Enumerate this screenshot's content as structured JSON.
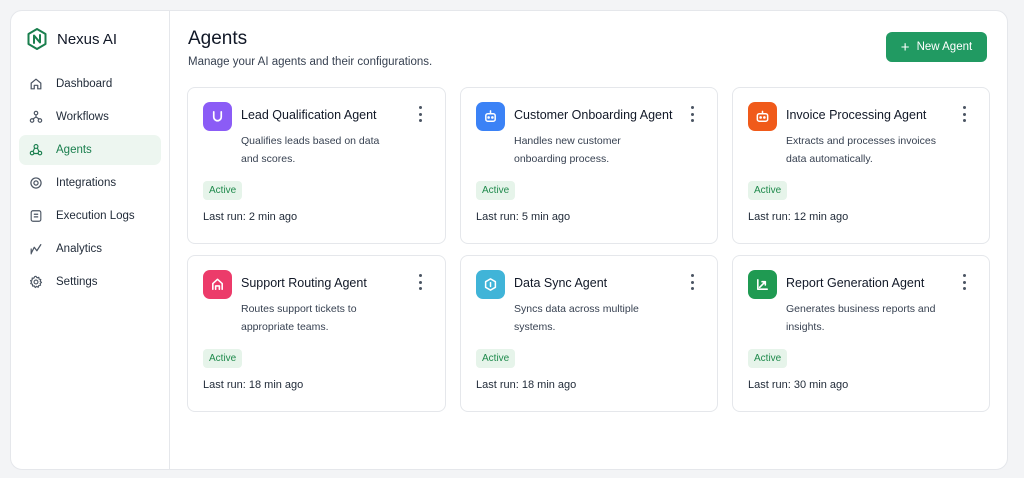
{
  "app": {
    "name": "Nexus AI"
  },
  "sidebar": {
    "items": [
      {
        "label": "Dashboard",
        "icon": "home-icon",
        "active": false
      },
      {
        "label": "Workflows",
        "icon": "workflow-icon",
        "active": false
      },
      {
        "label": "Agents",
        "icon": "agents-icon",
        "active": true
      },
      {
        "label": "Integrations",
        "icon": "integrations-icon",
        "active": false
      },
      {
        "label": "Execution Logs",
        "icon": "logs-icon",
        "active": false
      },
      {
        "label": "Analytics",
        "icon": "analytics-icon",
        "active": false
      },
      {
        "label": "Settings",
        "icon": "gear-icon",
        "active": false
      }
    ]
  },
  "header": {
    "title": "Agents",
    "subtitle": "Manage your AI agents and their configurations.",
    "new_button_label": "New Agent"
  },
  "agents": [
    {
      "name": "Lead Qualification Agent",
      "desc": "Qualifies leads based on data and scores.",
      "status": "Active",
      "last_run": "Last run: 2 min ago",
      "icon": "magnet-icon",
      "color": "#8b5cf6"
    },
    {
      "name": "Customer Onboarding Agent",
      "desc": "Handles new customer onboarding process.",
      "status": "Active",
      "last_run": "Last run: 5 min ago",
      "icon": "bot-icon",
      "color": "#3b82f6"
    },
    {
      "name": "Invoice Processing Agent",
      "desc": "Extracts and processes invoices data automatically.",
      "status": "Active",
      "last_run": "Last run: 12 min ago",
      "icon": "invoice-icon",
      "color": "#f05a1a"
    },
    {
      "name": "Support Routing Agent",
      "desc": "Routes support tickets to appropriate teams.",
      "status": "Active",
      "last_run": "Last run: 18 min ago",
      "icon": "routing-icon",
      "color": "#ec3b6a"
    },
    {
      "name": "Data Sync Agent",
      "desc": "Syncs data across multiple systems.",
      "status": "Active",
      "last_run": "Last run: 18 min ago",
      "icon": "sync-icon",
      "color": "#40b4d8"
    },
    {
      "name": "Report Generation Agent",
      "desc": "Generates business reports and insights.",
      "status": "Active",
      "last_run": "Last run: 30 min ago",
      "icon": "trend-icon",
      "color": "#1f9a52"
    }
  ],
  "colors": {
    "accent": "#219a62",
    "active_bg": "#edf6f0",
    "badge_bg": "#e6f4ea",
    "badge_text": "#1f8a4c"
  }
}
